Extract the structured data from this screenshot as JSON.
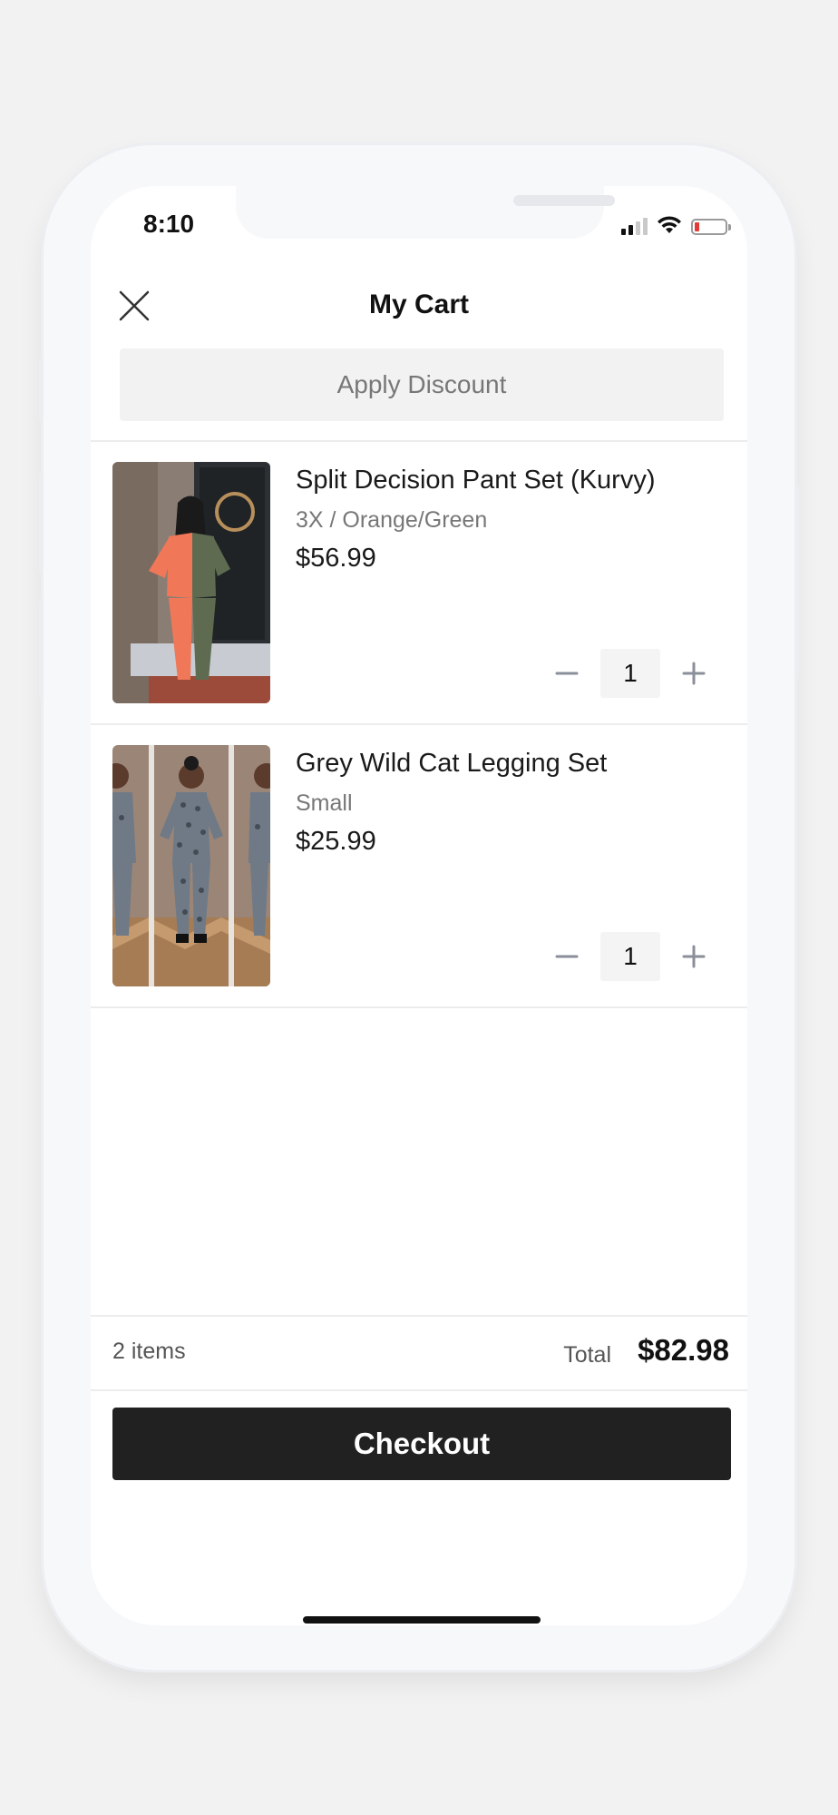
{
  "status": {
    "time": "8:10"
  },
  "header": {
    "title": "My Cart"
  },
  "discount": {
    "label": "Apply Discount"
  },
  "cart": {
    "items": [
      {
        "name": "Split Decision Pant Set (Kurvy)",
        "variant": "3X / Orange/Green",
        "price": "$56.99",
        "quantity": "1"
      },
      {
        "name": "Grey Wild Cat Legging Set",
        "variant": "Small",
        "price": "$25.99",
        "quantity": "1"
      }
    ]
  },
  "summary": {
    "item_count": "2 items",
    "total_label": "Total",
    "total_value": "$82.98"
  },
  "checkout": {
    "label": "Checkout"
  },
  "colors": {
    "background": "#f2f2f2",
    "checkout_button": "#212121",
    "battery_low": "#e53935"
  },
  "icons": [
    "close-icon",
    "minus-icon",
    "plus-icon",
    "signal-icon",
    "wifi-icon",
    "battery-icon"
  ]
}
